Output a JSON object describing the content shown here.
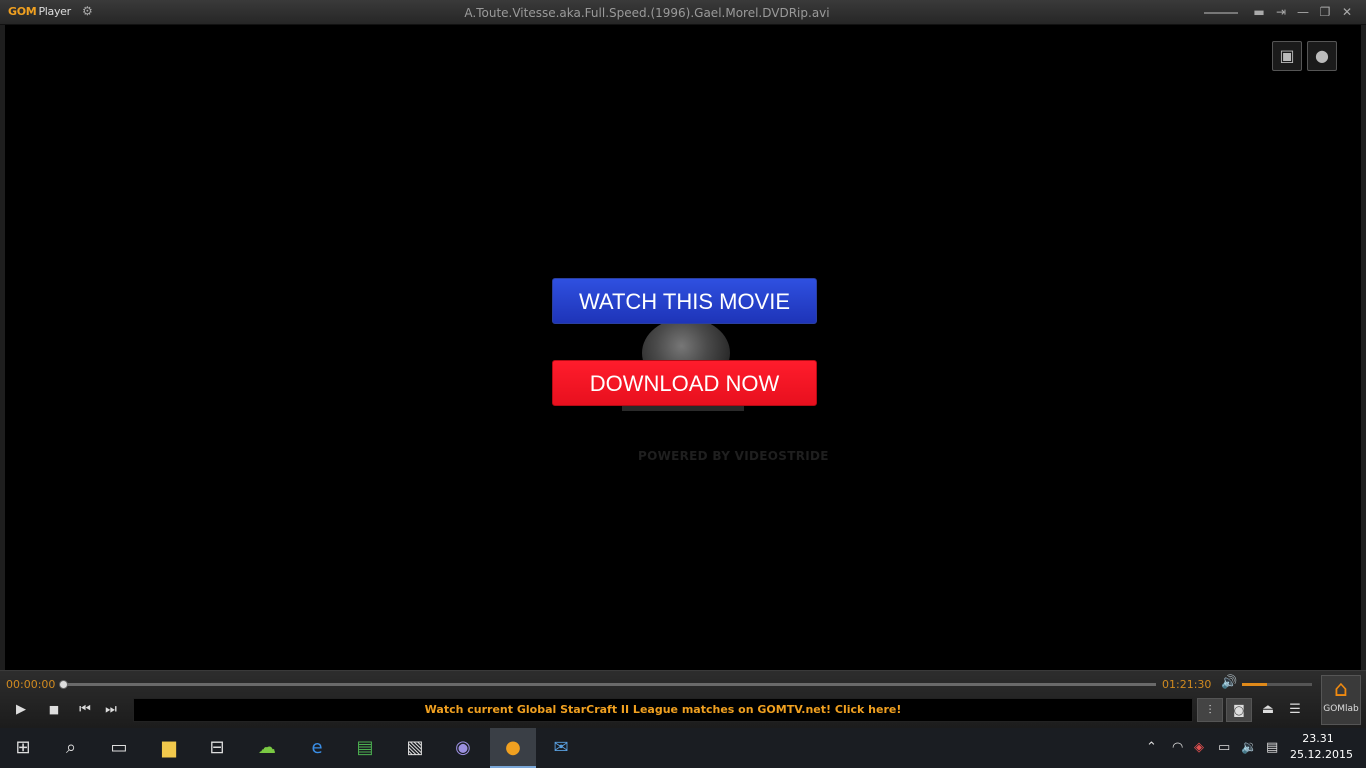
{
  "titlebar": {
    "logo_gom": "GOM",
    "logo_player": "Player",
    "settings_glyph": "⚙",
    "file_title": "A.Toute.Vitesse.aka.Full.Speed.(1996).Gael.Morel.DVDRip.avi",
    "icons": [
      "minimize-to-tray-icon",
      "pin-icon",
      "minimize-icon",
      "maximize-icon",
      "close-icon"
    ]
  },
  "overlay": {
    "watch_label": "WATCH THIS MOVIE",
    "download_label": "DOWNLOAD NOW",
    "powered_by": "POWERED BY VIDEOSTRIDE",
    "watch_color": "#2a46d6",
    "download_color": "#f8121f"
  },
  "store_icons": [
    "android-icon",
    "apple-icon"
  ],
  "controls": {
    "current_time": "00:00:00",
    "total_time": "01:21:30",
    "progress": 0,
    "volume": 0.35,
    "banner_text": "Watch current Global StarCraft II League matches on GOMTV.net! Click here!",
    "home_label": "GOMlab",
    "accent_color": "#f0a020"
  },
  "taskbar": {
    "icons": [
      "windows-start-icon",
      "search-icon",
      "task-view-icon",
      "file-explorer-icon",
      "store-icon",
      "app-green-icon",
      "edge-icon",
      "notes-icon",
      "photos-icon",
      "browser-app-icon",
      "gom-player-icon",
      "thunderbird-icon"
    ],
    "tray_icons": [
      "chevron-up-icon",
      "network-icon",
      "security-icon",
      "power-icon",
      "volume-icon",
      "action-center-icon"
    ],
    "time": "23.31",
    "date": "25.12.2015"
  }
}
